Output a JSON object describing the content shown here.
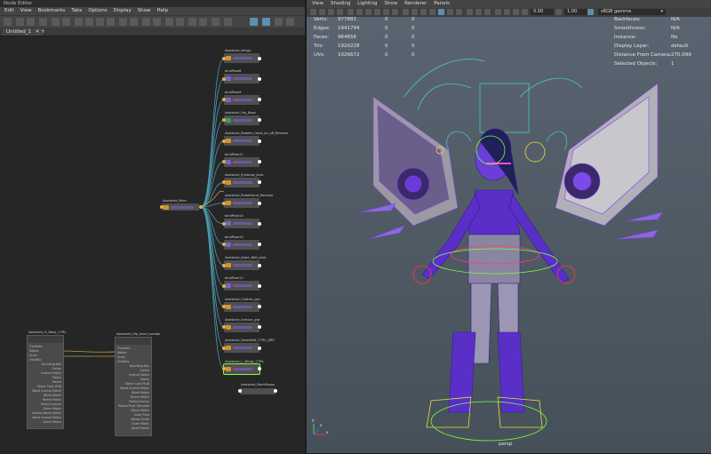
{
  "node_editor": {
    "title": "Node Editor",
    "menu": [
      "Edit",
      "View",
      "Bookmarks",
      "Tabs",
      "Options",
      "Display",
      "Show",
      "Help"
    ],
    "tab": "Untitled_1",
    "tab_close": "✕",
    "tab_add": "+",
    "hub_node": "Assistant_Main",
    "output_nodes": [
      "Assistant_Wings",
      "bindPose8",
      "bindPose9",
      "Assistant_Hip_Base",
      "Assistant_Robotic_hand_on_off_Reverse",
      "bindPose11",
      "Assistant_Eyebrow_Joint",
      "Assistant_RobotHand_Reverse",
      "bindPose14",
      "bindPose15",
      "Assistant_down_Belt_Joint",
      "bindPose12",
      "Assistant_Clothes_grp",
      "Assistant_Armour_grp",
      "Assistant_DownBelt_CTRL_GRP",
      "Assistant_L_Wings_CTRL"
    ],
    "shape_node": "Assistant_MainShape",
    "left_big_node": {
      "title": "Assistant_R_Body_CTRL",
      "rows": [
        "Translate",
        "Rotate",
        "Scale",
        "Visibility",
        "Bounding Box",
        "Center",
        "Inverse Matrix",
        "Matrix",
        "Parent",
        "Object Color RGB",
        "World Inverse Matrix",
        "World Matrix",
        "Parent Matrix",
        "Parent Inverse",
        "Xform Matrix",
        "Inverse World Matrix",
        "World Inverse Matrix",
        "Xform Matrix"
      ]
    },
    "right_big_node": {
      "title": "Assistant_Hip_level_Locator",
      "rows": [
        "Translate",
        "Rotate",
        "Scale",
        "Visibility",
        "Bounding Box",
        "Center",
        "Inverse Matrix",
        "Matrix",
        "Object Color RGB",
        "World Inverse Matrix",
        "World Matrix",
        "Parent Matrix",
        "Parent Inverse",
        "Rotate Pivot Translate",
        "Xform Matrix",
        "Scale Pivot",
        "Rotate Order",
        "Scale Matrix",
        "World Matrix"
      ]
    }
  },
  "viewport": {
    "menu": [
      "View",
      "Shading",
      "Lighting",
      "Show",
      "Renderer",
      "Panels"
    ],
    "exposure": "0.00",
    "gamma": "1.00",
    "color_space": "sRGB gamma",
    "camera_label": "persp",
    "stats": [
      {
        "label": "Verts:",
        "v1": "977881",
        "v2": "0",
        "v3": "0"
      },
      {
        "label": "Edges:",
        "v1": "1941794",
        "v2": "0",
        "v3": "0"
      },
      {
        "label": "Faces:",
        "v1": "964656",
        "v2": "0",
        "v3": "0"
      },
      {
        "label": "Tris:",
        "v1": "1920228",
        "v2": "0",
        "v3": "0"
      },
      {
        "label": "UVs:",
        "v1": "1026672",
        "v2": "0",
        "v3": "0"
      }
    ],
    "info": [
      {
        "label": "Backfaces:",
        "value": "N/A"
      },
      {
        "label": "Smoothness:",
        "value": "N/A"
      },
      {
        "label": "Instance:",
        "value": "No"
      },
      {
        "label": "Display Layer:",
        "value": "default"
      },
      {
        "label": "Distance From Camera:",
        "value": "270.099"
      },
      {
        "label": "Selected Objects:",
        "value": "1"
      }
    ],
    "axis": {
      "x": "x",
      "y": "y",
      "z": "z"
    }
  },
  "colors": {
    "selection_blue": "#5d8fb0",
    "wire_purple": "#7a2ef5",
    "control_green": "#7cff3a",
    "control_teal": "#3bd7c8"
  }
}
